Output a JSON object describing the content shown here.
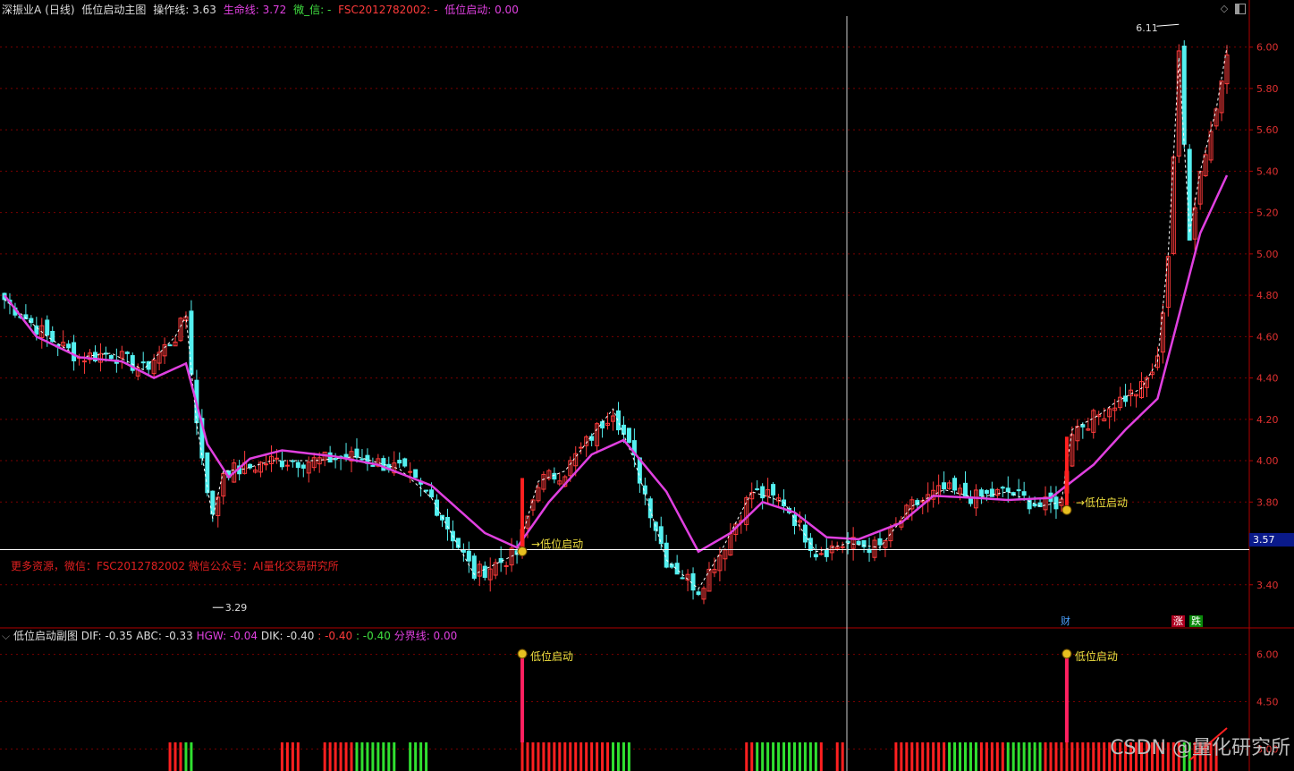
{
  "header": {
    "stock": "深振业A",
    "period": "(日线)",
    "indicator_name": "低位启动主图",
    "op_line_label": "操作线:",
    "op_line_value": "3.63",
    "life_line_label": "生命线:",
    "life_line_value": "3.72",
    "wechat_label": "微_信:",
    "wechat_value": "-",
    "fsc_label": "FSC2012782002:",
    "fsc_value": "-",
    "signal_label": "低位启动:",
    "signal_value": "0.00"
  },
  "sub_header": {
    "indicator_name": "低位启动副图",
    "dif": "DIF: -0.35",
    "abc": "ABC: -0.33",
    "hgw": "HGW: -0.04",
    "dik": "DIK: -0.40",
    "v1": ": -0.40",
    "v2": ": -0.40",
    "divider": "分界线: 0.00"
  },
  "note": "更多资源，微信：FSC2012782002 微信公众号：AI量化交易研究所",
  "current_price": "3.57",
  "max_label": "6.11",
  "min_label": "3.29",
  "signal_text": "低位启动",
  "badges": {
    "cai": "财",
    "zhang": "涨",
    "die": "跌"
  },
  "watermark": "CSDN @量化研究所",
  "colors": {
    "up": "#ff3b3b",
    "down": "#54f0f0",
    "life": "#e040e0",
    "grid": "#7a0000",
    "axis": "#b00000",
    "signal_bar": "#ff2060",
    "bar_up": "#ff2020",
    "bar_down": "#30e030"
  },
  "chart_data": [
    {
      "type": "candlestick",
      "title": "低位启动主图",
      "ylim": [
        3.2,
        6.15
      ],
      "y_ticks": [
        3.4,
        3.6,
        3.8,
        4.0,
        4.2,
        4.4,
        4.6,
        4.8,
        5.0,
        5.2,
        5.4,
        5.6,
        5.8,
        6.0
      ],
      "y_tick_labels": [
        "3.40",
        "3.80",
        "4.00",
        "4.20",
        "4.40",
        "4.60",
        "4.80",
        "5.00",
        "5.20",
        "5.40",
        "5.60",
        "5.80",
        "6.00"
      ],
      "close_anchors": [
        [
          0,
          4.78
        ],
        [
          8,
          4.6
        ],
        [
          14,
          4.5
        ],
        [
          20,
          4.52
        ],
        [
          26,
          4.44
        ],
        [
          32,
          4.6
        ],
        [
          34,
          4.7
        ],
        [
          36,
          4.18
        ],
        [
          39,
          3.72
        ],
        [
          41,
          3.95
        ],
        [
          45,
          3.96
        ],
        [
          50,
          4.0
        ],
        [
          58,
          4.0
        ],
        [
          66,
          4.02
        ],
        [
          74,
          3.96
        ],
        [
          80,
          3.82
        ],
        [
          88,
          3.45
        ],
        [
          96,
          3.55
        ],
        [
          100,
          3.9
        ],
        [
          105,
          3.95
        ],
        [
          110,
          4.12
        ],
        [
          114,
          4.25
        ],
        [
          118,
          4.0
        ],
        [
          124,
          3.52
        ],
        [
          130,
          3.38
        ],
        [
          134,
          3.55
        ],
        [
          140,
          3.85
        ],
        [
          146,
          3.8
        ],
        [
          152,
          3.56
        ],
        [
          158,
          3.6
        ],
        [
          164,
          3.58
        ],
        [
          170,
          3.78
        ],
        [
          176,
          3.86
        ],
        [
          182,
          3.82
        ],
        [
          188,
          3.85
        ],
        [
          194,
          3.78
        ],
        [
          198,
          3.8
        ],
        [
          200,
          4.15
        ],
        [
          205,
          4.22
        ],
        [
          208,
          4.28
        ],
        [
          213,
          4.35
        ],
        [
          216,
          4.48
        ],
        [
          218,
          5.0
        ],
        [
          220,
          5.95
        ],
        [
          222,
          5.1
        ],
        [
          224,
          5.4
        ],
        [
          227,
          5.7
        ],
        [
          229,
          6.0
        ]
      ],
      "life_anchors": [
        [
          0,
          4.8
        ],
        [
          6,
          4.6
        ],
        [
          14,
          4.5
        ],
        [
          22,
          4.48
        ],
        [
          28,
          4.4
        ],
        [
          34,
          4.47
        ],
        [
          38,
          4.08
        ],
        [
          42,
          3.92
        ],
        [
          46,
          4.01
        ],
        [
          52,
          4.05
        ],
        [
          62,
          4.02
        ],
        [
          70,
          3.98
        ],
        [
          80,
          3.88
        ],
        [
          90,
          3.65
        ],
        [
          96,
          3.58
        ],
        [
          102,
          3.8
        ],
        [
          110,
          4.03
        ],
        [
          116,
          4.1
        ],
        [
          124,
          3.85
        ],
        [
          130,
          3.56
        ],
        [
          136,
          3.65
        ],
        [
          142,
          3.8
        ],
        [
          148,
          3.75
        ],
        [
          154,
          3.63
        ],
        [
          160,
          3.62
        ],
        [
          168,
          3.7
        ],
        [
          174,
          3.83
        ],
        [
          182,
          3.82
        ],
        [
          188,
          3.81
        ],
        [
          196,
          3.82
        ],
        [
          204,
          3.98
        ],
        [
          210,
          4.15
        ],
        [
          216,
          4.3
        ],
        [
          220,
          4.7
        ],
        [
          224,
          5.1
        ],
        [
          229,
          5.38
        ]
      ],
      "signals_main": [
        {
          "i": 97,
          "price": 3.57
        },
        {
          "i": 199,
          "price": 3.77
        }
      ],
      "max_point": {
        "i": 220,
        "value": 6.11
      },
      "min_point": {
        "i": 39,
        "value": 3.29
      }
    },
    {
      "type": "bar",
      "title": "低位启动副图",
      "ylim": [
        2.3,
        6.5
      ],
      "y_ticks": [
        3.0,
        4.5,
        6.0
      ],
      "signals_sub": [
        {
          "i": 97
        },
        {
          "i": 199
        }
      ],
      "red_green_pattern": "state by trend of close"
    }
  ]
}
